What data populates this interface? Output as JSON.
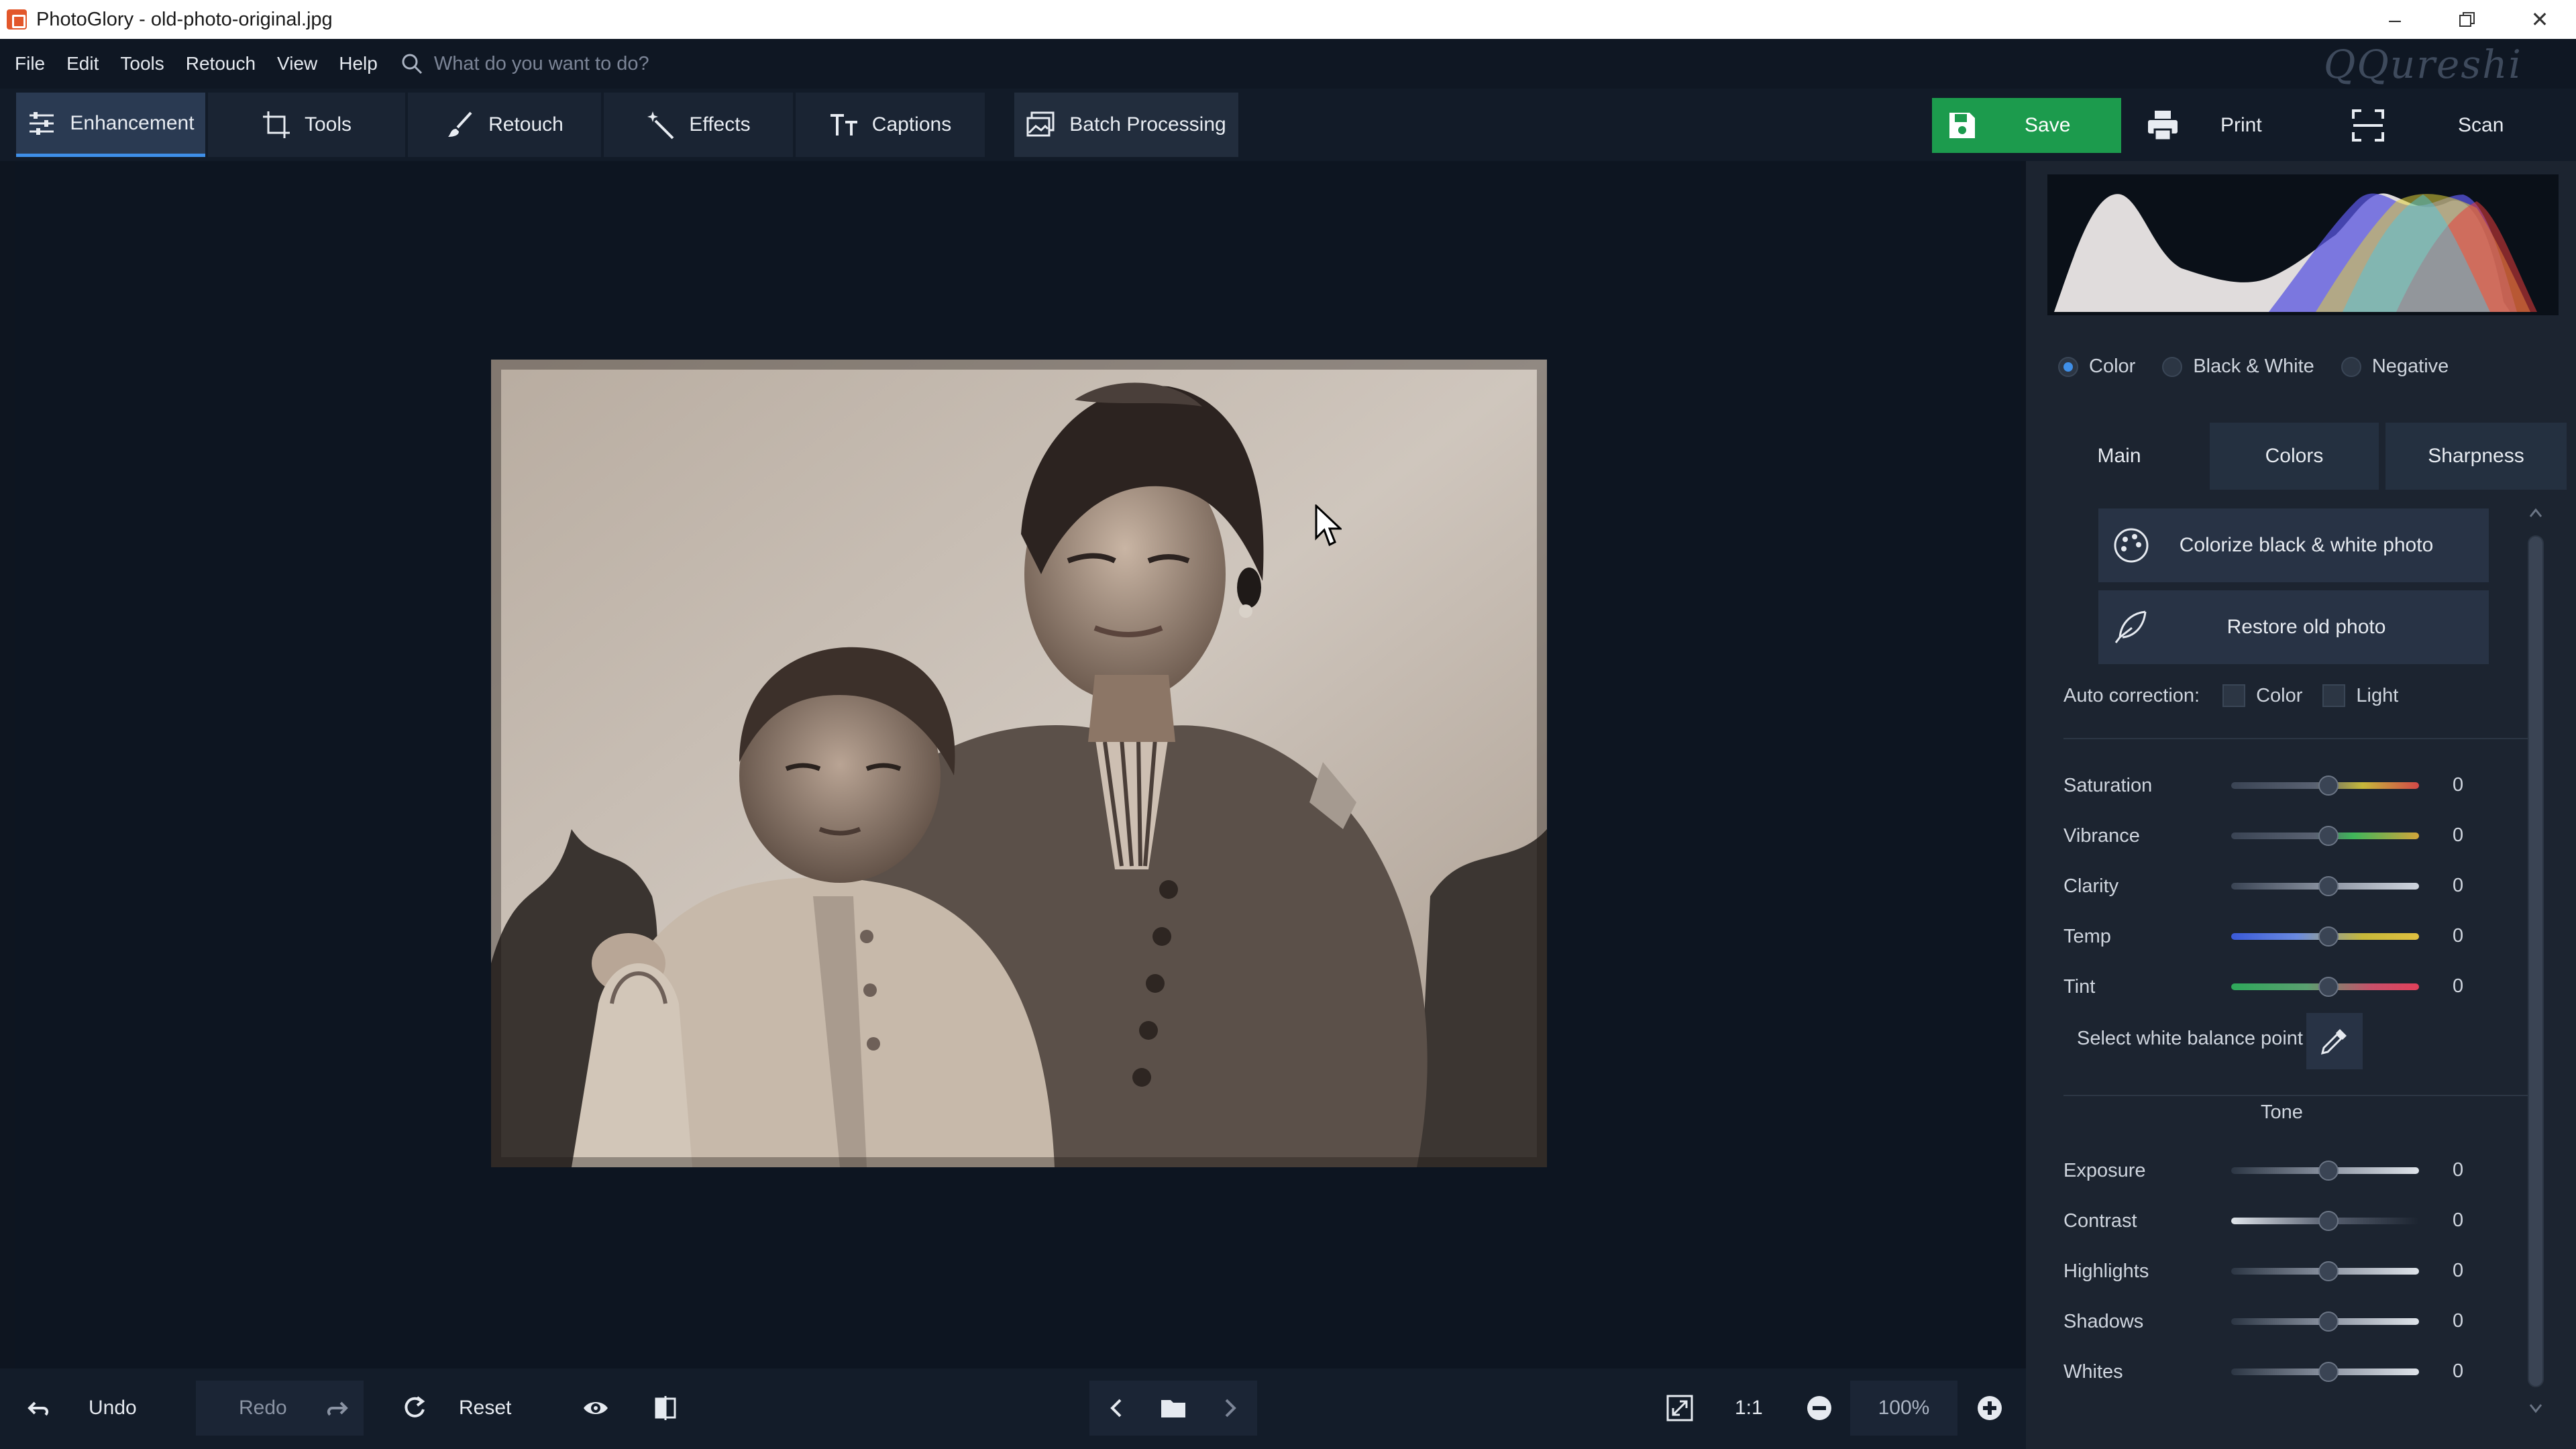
{
  "window": {
    "title": "PhotoGlory - old-photo-original.jpg"
  },
  "menu": {
    "items": [
      "File",
      "Edit",
      "Tools",
      "Retouch",
      "View",
      "Help"
    ],
    "search_placeholder": "What do you want to do?"
  },
  "watermark": "QQureshi",
  "toolbar": {
    "tabs": [
      "Enhancement",
      "Tools",
      "Retouch",
      "Effects",
      "Captions",
      "Batch Processing"
    ],
    "active_tab": "Enhancement",
    "save_label": "Save",
    "print_label": "Print",
    "scan_label": "Scan"
  },
  "bottom": {
    "undo_label": "Undo",
    "redo_label": "Redo",
    "reset_label": "Reset",
    "ratio_label": "1:1",
    "zoom_value": "100%"
  },
  "panel": {
    "modes": [
      "Color",
      "Black & White",
      "Negative"
    ],
    "selected_mode": "Color",
    "tabs": [
      "Main",
      "Colors",
      "Sharpness"
    ],
    "active_tab": "Main",
    "colorize_label": "Colorize black & white photo",
    "restore_label": "Restore old photo",
    "auto_correction": {
      "label": "Auto correction:",
      "options": [
        "Color",
        "Light"
      ]
    },
    "color_sliders": [
      {
        "label": "Saturation",
        "value": "0"
      },
      {
        "label": "Vibrance",
        "value": "0"
      },
      {
        "label": "Clarity",
        "value": "0"
      },
      {
        "label": "Temp",
        "value": "0"
      },
      {
        "label": "Tint",
        "value": "0"
      }
    ],
    "white_balance_label": "Select white balance point",
    "tone_title": "Tone",
    "tone_sliders": [
      {
        "label": "Exposure",
        "value": "0"
      },
      {
        "label": "Contrast",
        "value": "0"
      },
      {
        "label": "Highlights",
        "value": "0"
      },
      {
        "label": "Shadows",
        "value": "0"
      },
      {
        "label": "Whites",
        "value": "0"
      }
    ]
  },
  "colors": {
    "accent": "#3f8fe8",
    "save_green": "#1c9b4d",
    "panel_bg": "#1c2430",
    "canvas_bg": "#0d1521"
  }
}
